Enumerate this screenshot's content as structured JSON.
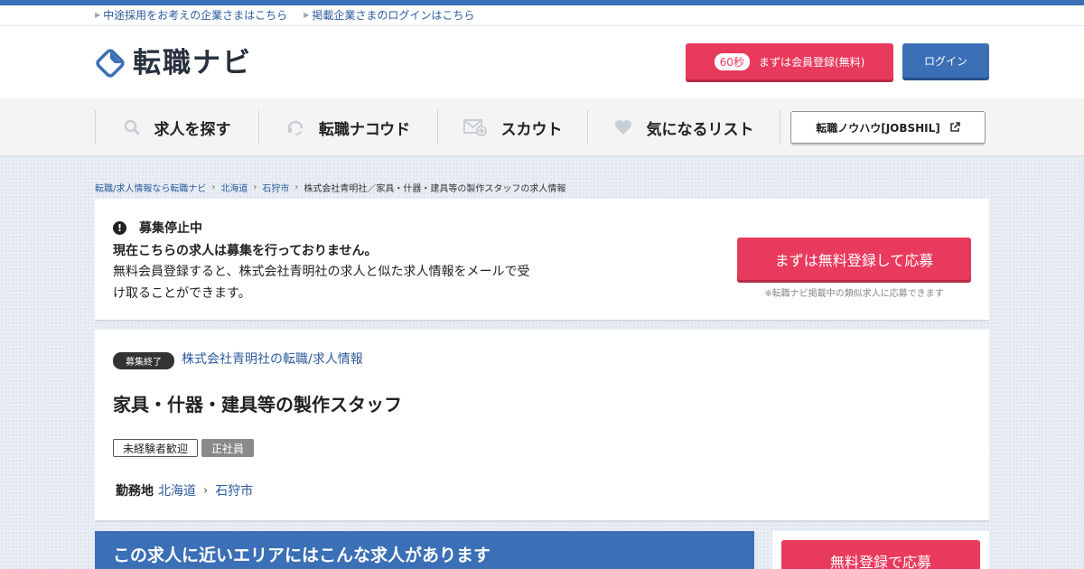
{
  "util_links": [
    "中途採用をお考えの企業さまはこちら",
    "掲載企業さまのログインはこちら"
  ],
  "logo": {
    "text": "転職ナビ"
  },
  "header": {
    "register_pill": "60秒",
    "register_label": "まずは会員登録(無料)",
    "login_label": "ログイン"
  },
  "nav": {
    "items": [
      {
        "label": "求人を探す",
        "icon": "search-icon"
      },
      {
        "label": "転職ナコウド",
        "icon": "headset-icon"
      },
      {
        "label": "スカウト",
        "icon": "mail-plus-icon"
      },
      {
        "label": "気になるリスト",
        "icon": "heart-icon"
      }
    ],
    "jobshil_label": "転職ノウハウ[JOBSHIL]"
  },
  "breadcrumb": [
    "転職/求人情報なら転職ナビ",
    "北海道",
    "石狩市",
    "株式会社青明社／家具・什器・建具等の製作スタッフの求人情報"
  ],
  "closed_notice": {
    "status": "募集停止中",
    "title": "現在こちらの求人は募集を行っておりません。",
    "desc": "無料会員登録すると、株式会社青明社の求人と似た求人情報をメールで受け取ることができます。",
    "apply_label": "まずは無料登録して応募",
    "apply_note": "※転職ナビ掲載中の類似求人に応募できます"
  },
  "job": {
    "badge": "募集終了",
    "company_link": "株式会社青明社の転職/求人情報",
    "title": "家具・什器・建具等の製作スタッフ",
    "tags": [
      "未経験者歓迎",
      "正社員"
    ],
    "location_label": "勤務地",
    "location": [
      "北海道",
      "石狩市"
    ]
  },
  "bottom": {
    "near_jobs_heading": "この求人に近いエリアにはこんな求人があります",
    "side_apply_label": "無料登録で応募"
  },
  "colors": {
    "brand_blue": "#3b6fb6",
    "accent_pink": "#e83a5c"
  }
}
